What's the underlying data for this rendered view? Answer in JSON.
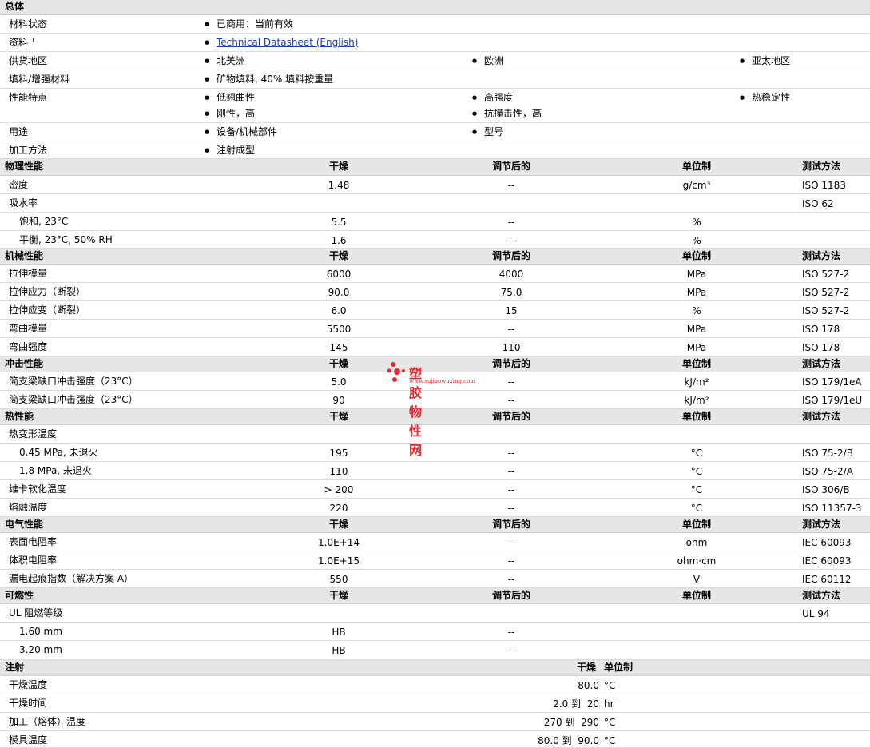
{
  "general": {
    "title": "总体",
    "material_status_label": "材料状态",
    "material_status_value": "已商用：当前有效",
    "data_label": "资料",
    "data_sup": "1",
    "data_link": "Technical Datasheet (English)",
    "supply_label": "供货地区",
    "supply_values": [
      "北美洲",
      "欧洲",
      "亚太地区"
    ],
    "filler_label": "填料/增强材料",
    "filler_value": "矿物填料, 40% 填料按重量",
    "features_label": "性能特点",
    "features_values": [
      "低翘曲性",
      "高强度",
      "热稳定性",
      "刚性，高",
      "抗撞击性，高"
    ],
    "uses_label": "用途",
    "uses_values": [
      "设备/机械部件",
      "型号"
    ],
    "processing_label": "加工方法",
    "processing_value": "注射成型"
  },
  "columns": {
    "dry": "干燥",
    "conditioned": "调节后的",
    "unit": "单位制",
    "method": "测试方法"
  },
  "sections": [
    {
      "title": "物理性能",
      "rows": [
        {
          "name": "密度",
          "dry": "1.48",
          "cond": "--",
          "unit": "g/cm³",
          "method": "ISO 1183"
        },
        {
          "name": "吸水率",
          "dry": "",
          "cond": "",
          "unit": "",
          "method": "ISO 62"
        },
        {
          "name": "饱和, 23°C",
          "dry": "5.5",
          "cond": "--",
          "unit": "%",
          "method": ""
        },
        {
          "name": "平衡, 23°C, 50% RH",
          "dry": "1.6",
          "cond": "--",
          "unit": "%",
          "method": ""
        }
      ]
    },
    {
      "title": "机械性能",
      "rows": [
        {
          "name": "拉伸模量",
          "dry": "6000",
          "cond": "4000",
          "unit": "MPa",
          "method": "ISO 527-2"
        },
        {
          "name": "拉伸应力（断裂）",
          "dry": "90.0",
          "cond": "75.0",
          "unit": "MPa",
          "method": "ISO 527-2"
        },
        {
          "name": "拉伸应变（断裂）",
          "dry": "6.0",
          "cond": "15",
          "unit": "%",
          "method": "ISO 527-2"
        },
        {
          "name": "弯曲模量",
          "dry": "5500",
          "cond": "--",
          "unit": "MPa",
          "method": "ISO 178"
        },
        {
          "name": "弯曲强度",
          "dry": "145",
          "cond": "110",
          "unit": "MPa",
          "method": "ISO 178"
        }
      ]
    },
    {
      "title": "冲击性能",
      "rows": [
        {
          "name": "简支梁缺口冲击强度（23°C）",
          "dry": "5.0",
          "cond": "--",
          "unit": "kJ/m²",
          "method": "ISO 179/1eA"
        },
        {
          "name": "简支梁缺口冲击强度（23°C）",
          "dry": "90",
          "cond": "--",
          "unit": "kJ/m²",
          "method": "ISO 179/1eU"
        }
      ]
    },
    {
      "title": "热性能",
      "rows": [
        {
          "name": "热变形温度",
          "dry": "",
          "cond": "",
          "unit": "",
          "method": ""
        },
        {
          "name": "0.45 MPa, 未退火",
          "dry": "195",
          "cond": "--",
          "unit": "°C",
          "method": "ISO 75-2/B"
        },
        {
          "name": "1.8 MPa, 未退火",
          "dry": "110",
          "cond": "--",
          "unit": "°C",
          "method": "ISO 75-2/A"
        },
        {
          "name": "维卡软化温度",
          "dry": "> 200",
          "cond": "--",
          "unit": "°C",
          "method": "ISO 306/B"
        },
        {
          "name": "熔融温度",
          "dry": "220",
          "cond": "--",
          "unit": "°C",
          "method": "ISO 11357-3"
        }
      ]
    },
    {
      "title": "电气性能",
      "rows": [
        {
          "name": "表面电阻率",
          "dry": "1.0E+14",
          "cond": "--",
          "unit": "ohm",
          "method": "IEC 60093"
        },
        {
          "name": "体积电阻率",
          "dry": "1.0E+15",
          "cond": "--",
          "unit": "ohm·cm",
          "method": "IEC 60093"
        },
        {
          "name": "漏电起痕指数（解决方案 A）",
          "dry": "550",
          "cond": "--",
          "unit": "V",
          "method": "IEC 60112"
        }
      ]
    },
    {
      "title": "可燃性",
      "rows": [
        {
          "name": "UL 阻燃等级",
          "dry": "",
          "cond": "",
          "unit": "",
          "method": "UL 94"
        },
        {
          "name": "1.60 mm",
          "dry": "HB",
          "cond": "--",
          "unit": "",
          "method": ""
        },
        {
          "name": "3.20 mm",
          "dry": "HB",
          "cond": "--",
          "unit": "",
          "method": ""
        }
      ]
    }
  ],
  "injection": {
    "title": "注射",
    "dry_header": "干燥",
    "unit_header": "单位制",
    "rows": [
      {
        "name": "干燥温度",
        "value": "80.0",
        "unit": "°C"
      },
      {
        "name": "干燥时间",
        "value": "2.0 到  20",
        "unit": "hr"
      },
      {
        "name": "加工（熔体）温度",
        "value": "270 到  290",
        "unit": "°C"
      },
      {
        "name": "模具温度",
        "value": "80.0 到  90.0",
        "unit": "°C"
      }
    ]
  },
  "watermark": {
    "title": "塑胶物性网",
    "url": "www.sujiaowuxing.com"
  }
}
